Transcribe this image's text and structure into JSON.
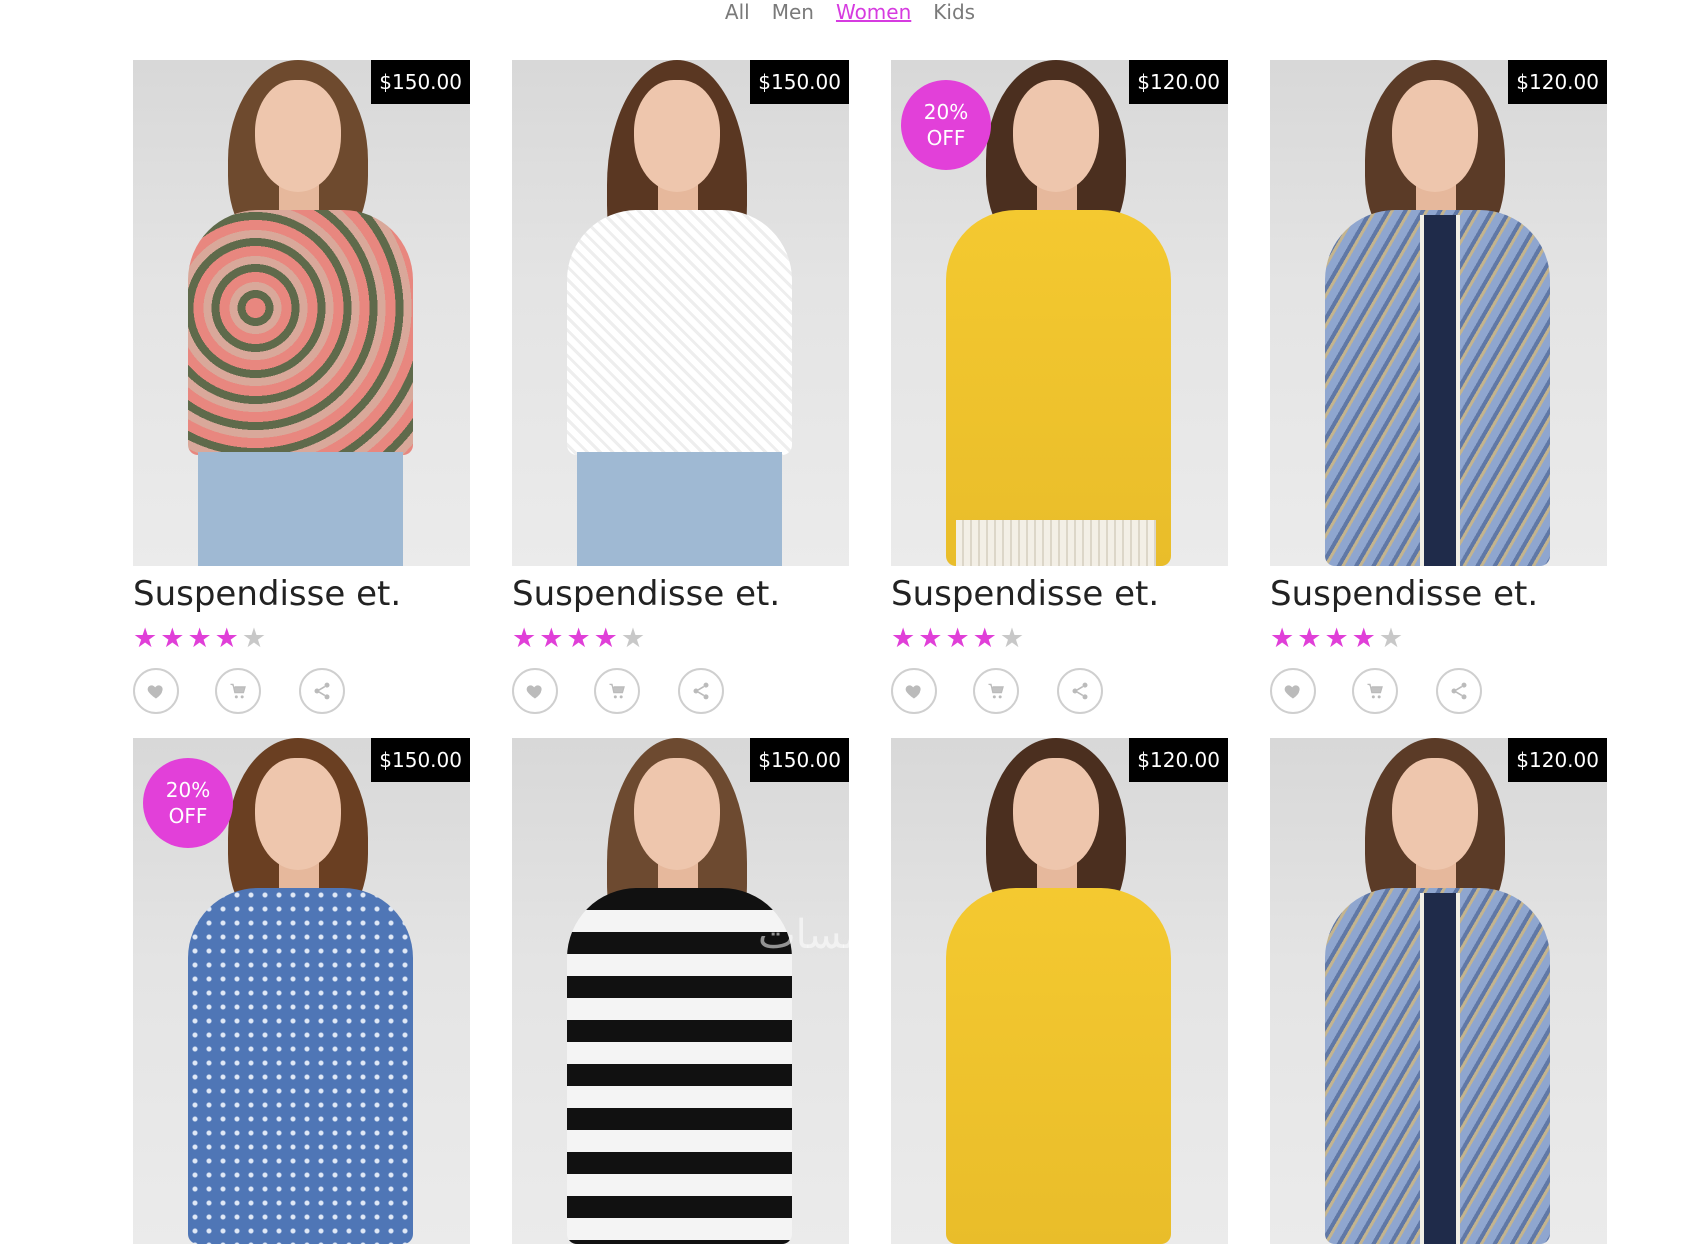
{
  "filters": [
    {
      "label": "All"
    },
    {
      "label": "Men"
    },
    {
      "label": "Women",
      "active": true
    },
    {
      "label": "Kids"
    }
  ],
  "accent_color": "#e240d9",
  "products": [
    {
      "price": "$150.00",
      "badge": "",
      "title": "Suspendisse et.",
      "rating": 4,
      "max_rating": 5,
      "outfit": "floral blouse"
    },
    {
      "price": "$150.00",
      "badge": "",
      "title": "Suspendisse et.",
      "rating": 4,
      "max_rating": 5,
      "outfit": "white lace blouse"
    },
    {
      "price": "$120.00",
      "badge": "20% OFF",
      "title": "Suspendisse et.",
      "rating": 4,
      "max_rating": 5,
      "outfit": "yellow top"
    },
    {
      "price": "$120.00",
      "badge": "",
      "title": "Suspendisse et.",
      "rating": 4,
      "max_rating": 5,
      "outfit": "blue batik blouse"
    },
    {
      "price": "$150.00",
      "badge": "20% OFF",
      "title": "",
      "rating": null,
      "max_rating": 5,
      "outfit": "blue polka-dot shirt"
    },
    {
      "price": "$150.00",
      "badge": "",
      "title": "",
      "rating": null,
      "max_rating": 5,
      "outfit": "black and white striped top"
    },
    {
      "price": "$120.00",
      "badge": "",
      "title": "",
      "rating": null,
      "max_rating": 5,
      "outfit": "yellow top"
    },
    {
      "price": "$120.00",
      "badge": "",
      "title": "",
      "rating": null,
      "max_rating": 5,
      "outfit": "blue batik blouse"
    }
  ],
  "actions": {
    "wishlist_icon": "heart-icon",
    "cart_icon": "cart-icon",
    "share_icon": "share-icon"
  },
  "watermark": "خمسات"
}
